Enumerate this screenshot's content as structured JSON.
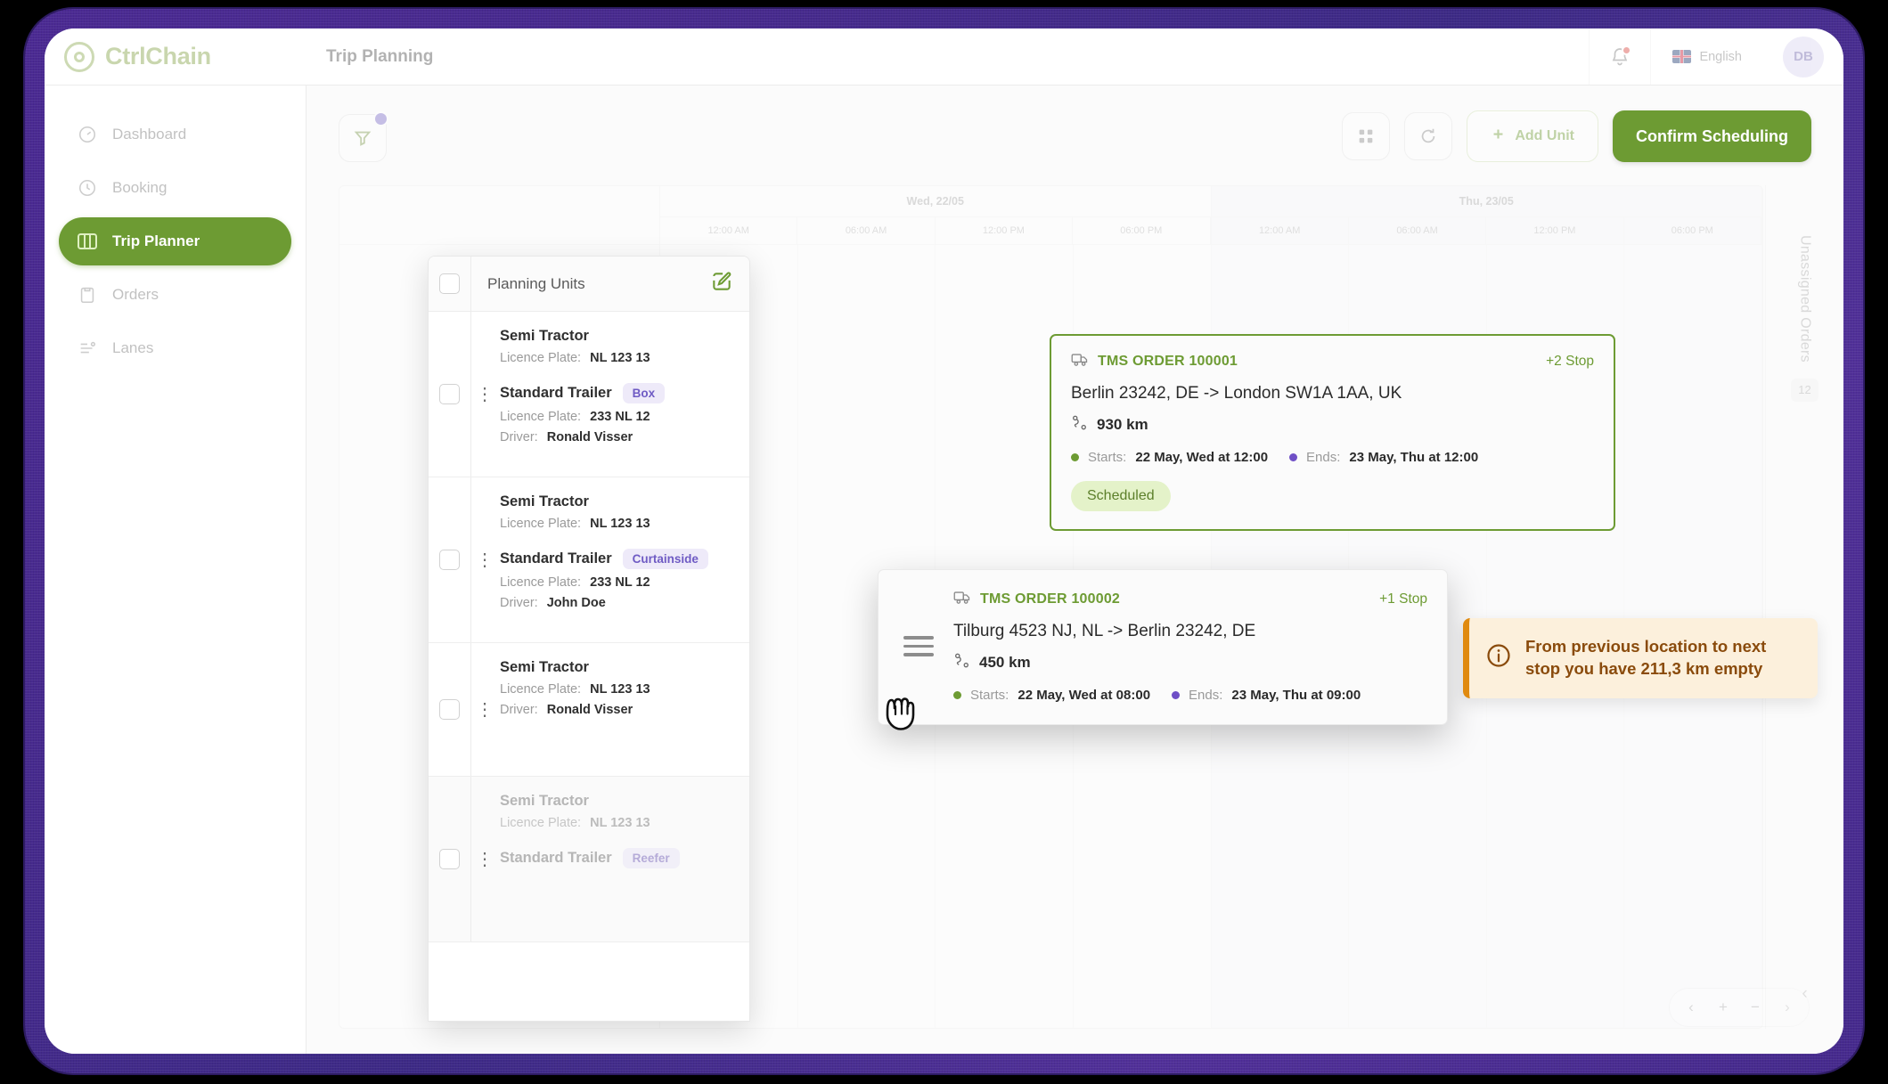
{
  "brand": {
    "name": "CtrlChain",
    "logo_icon": "target-circle-icon"
  },
  "header": {
    "page_title": "Trip Planning",
    "notifications_icon": "bell-icon",
    "language_label": "English",
    "language_flag": "uk-flag-icon",
    "avatar_initials": "DB"
  },
  "sidebar": {
    "items": [
      {
        "label": "Dashboard",
        "icon": "dashboard-icon",
        "active": false
      },
      {
        "label": "Booking",
        "icon": "booking-icon",
        "active": false
      },
      {
        "label": "Trip Planner",
        "icon": "columns-icon",
        "active": true
      },
      {
        "label": "Orders",
        "icon": "clipboard-icon",
        "active": false
      },
      {
        "label": "Lanes",
        "icon": "lanes-icon",
        "active": false
      }
    ]
  },
  "toolbar": {
    "filter_icon": "filter-funnel-icon",
    "filter_badge": "",
    "grid_view_icon": "grid-view-icon",
    "refresh_icon": "refresh-icon",
    "add_unit_label": "Add Unit",
    "add_unit_icon": "plus-icon",
    "confirm_label": "Confirm Scheduling"
  },
  "timeline": {
    "days": [
      {
        "label": "Wed, 22/05",
        "hours": [
          "12:00 AM",
          "06:00 AM",
          "12:00 PM",
          "06:00 PM"
        ]
      },
      {
        "label": "Thu, 23/05",
        "hours": [
          "12:00 AM",
          "06:00 AM",
          "12:00 PM",
          "06:00 PM"
        ]
      }
    ],
    "pager": {
      "prev": "‹",
      "zoom_in": "+",
      "zoom_out": "−",
      "next": "›"
    }
  },
  "rail": {
    "title": "Unassigned Orders",
    "count": "12",
    "collapse_icon": "chevron-left-icon"
  },
  "units_panel": {
    "title": "Planning Units",
    "edit_icon": "edit-pencil-icon",
    "select_all_checkbox": "unchecked",
    "labels": {
      "licence_plate": "Licence Plate:",
      "driver": "Driver:"
    },
    "rows": [
      {
        "tractor": "Semi Tractor",
        "tractor_plate": "NL 123 13",
        "trailer": "Standard Trailer",
        "trailer_tag": "Box",
        "trailer_plate": "233 NL 12",
        "driver": "Ronald Visser",
        "faded": false
      },
      {
        "tractor": "Semi Tractor",
        "tractor_plate": "NL 123 13",
        "trailer": "Standard Trailer",
        "trailer_tag": "Curtainside",
        "trailer_plate": "233 NL 12",
        "driver": "John Doe",
        "faded": false
      },
      {
        "tractor": "Semi Tractor",
        "tractor_plate": "NL 123 13",
        "trailer": null,
        "trailer_tag": null,
        "trailer_plate": null,
        "driver": "Ronald Visser",
        "faded": false
      },
      {
        "tractor": "Semi Tractor",
        "tractor_plate": "NL 123 13",
        "trailer": "Standard Trailer",
        "trailer_tag": "Reefer",
        "trailer_plate": null,
        "driver": null,
        "faded": true
      }
    ]
  },
  "orders": {
    "scheduled": {
      "truck_icon": "truck-icon",
      "id": "TMS ORDER 100001",
      "stops": "+2 Stop",
      "route": "Berlin 23242, DE -> London SW1A 1AA, UK",
      "distance_icon": "route-icon",
      "distance": "930 km",
      "starts_label": "Starts:",
      "starts_value": "22 May, Wed at 12:00",
      "ends_label": "Ends:",
      "ends_value": "23 May, Thu at 12:00",
      "status": "Scheduled"
    },
    "dragging": {
      "truck_icon": "truck-icon",
      "drag_handle_icon": "drag-handle-icon",
      "id": "TMS ORDER 100002",
      "stops": "+1 Stop",
      "route": "Tilburg 4523 NJ, NL -> Berlin 23242, DE",
      "distance_icon": "route-icon",
      "distance": "450 km",
      "starts_label": "Starts:",
      "starts_value": "22 May, Wed at 08:00",
      "ends_label": "Ends:",
      "ends_value": "23 May, Thu at 09:00"
    }
  },
  "tooltip": {
    "icon": "info-circle-icon",
    "text": "From previous location to next stop you have 211,3 km empty"
  },
  "colors": {
    "brand_green": "#6d9b33",
    "accent_purple": "#7b6bc9",
    "warning_amber": "#e08a10",
    "warning_bg": "#fcf0dc",
    "status_bg": "#e4f2c9",
    "frame_purple": "#4b2a93",
    "notification_red": "#d8403a"
  }
}
